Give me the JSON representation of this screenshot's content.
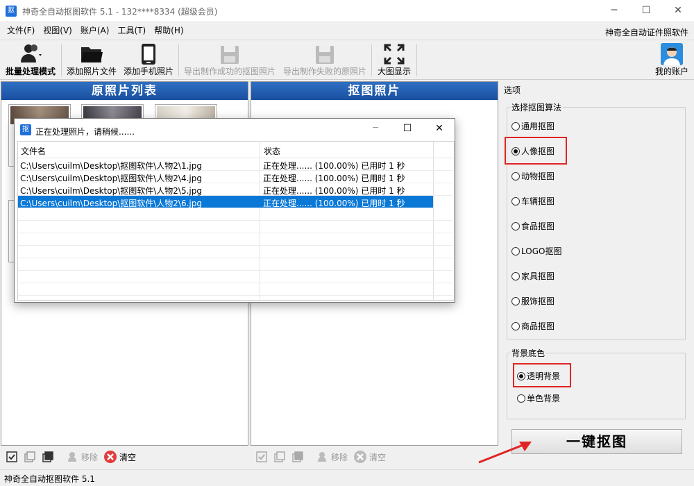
{
  "window": {
    "title": "神奇全自动抠图软件 5.1 - 132****8334 (超级会员)",
    "icon_char": "抠",
    "minimize": "─",
    "maximize": "☐",
    "close": "✕"
  },
  "menu": {
    "items": [
      "文件(F)",
      "视图(V)",
      "账户(A)",
      "工具(T)",
      "帮助(H)"
    ],
    "right_link": "神奇全自动证件照软件"
  },
  "toolbar": {
    "batch": "批量处理模式",
    "add_file": "添加照片文件",
    "add_phone": "添加手机照片",
    "export_success": "导出制作成功的抠图照片",
    "export_fail": "导出制作失败的原照片",
    "large_view": "大图显示",
    "account": "我的账户"
  },
  "left_panel": {
    "header": "原照片列表",
    "remove": "移除",
    "clear": "清空"
  },
  "mid_panel": {
    "header": "抠图照片",
    "remove": "移除",
    "clear": "清空"
  },
  "options": {
    "title": "选项",
    "algo_group": "选择抠图算法",
    "algorithms": [
      {
        "label": "通用抠图",
        "checked": false
      },
      {
        "label": "人像抠图",
        "checked": true
      },
      {
        "label": "动物抠图",
        "checked": false
      },
      {
        "label": "车辆抠图",
        "checked": false
      },
      {
        "label": "食品抠图",
        "checked": false
      },
      {
        "label": "LOGO抠图",
        "checked": false
      },
      {
        "label": "家具抠图",
        "checked": false
      },
      {
        "label": "服饰抠图",
        "checked": false
      },
      {
        "label": "商品抠图",
        "checked": false
      }
    ],
    "bg_group": "背景底色",
    "bg_options": [
      {
        "label": "透明背景",
        "checked": true
      },
      {
        "label": "单色背景",
        "checked": false
      }
    ],
    "main_button": "一键抠图",
    "highlight_color": "#e02424"
  },
  "dialog": {
    "title": "正在处理照片，请稍候......",
    "col_file": "文件名",
    "col_status": "状态",
    "rows": [
      {
        "file": "C:\\Users\\cuilm\\Desktop\\抠图软件\\人物2\\1.jpg",
        "status": "正在处理...... (100.00%) 已用时 1 秒",
        "selected": false
      },
      {
        "file": "C:\\Users\\cuilm\\Desktop\\抠图软件\\人物2\\4.jpg",
        "status": "正在处理...... (100.00%) 已用时 1 秒",
        "selected": false
      },
      {
        "file": "C:\\Users\\cuilm\\Desktop\\抠图软件\\人物2\\5.jpg",
        "status": "正在处理...... (100.00%) 已用时 1 秒",
        "selected": false
      },
      {
        "file": "C:\\Users\\cuilm\\Desktop\\抠图软件\\人物2\\6.jpg",
        "status": "正在处理...... (100.00%) 已用时 1 秒",
        "selected": true
      }
    ],
    "minimize": "─",
    "maximize": "☐",
    "close": "✕"
  },
  "status_bar": {
    "text": "神奇全自动抠图软件 5.1"
  }
}
